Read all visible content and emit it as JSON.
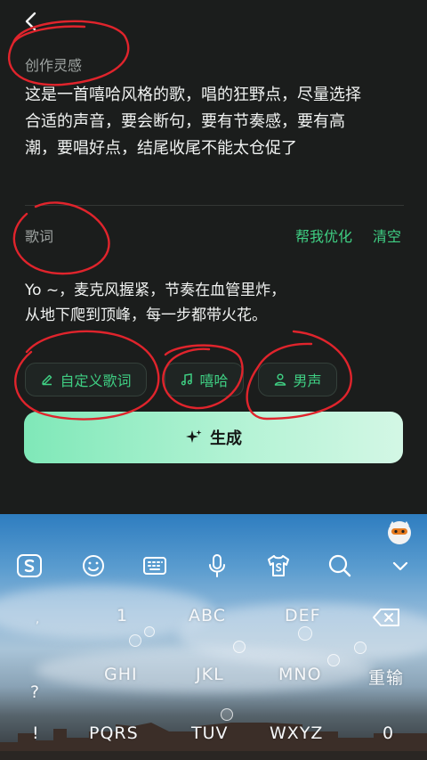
{
  "header": {
    "back_icon": "chevron-left-icon"
  },
  "inspiration": {
    "label": "创作灵感",
    "lines": [
      "这是一首嘻哈风格的歌，唱的狂野点，尽量选择",
      "合适的声音，要会断句，要有节奏感，要有高",
      "潮，要唱好点，结尾收尾不能太仓促了"
    ]
  },
  "lyrics": {
    "label": "歌词",
    "optimize_label": "帮我优化",
    "clear_label": "清空",
    "lines": [
      "Yo ~，麦克风握紧，节奏在血管里炸，",
      "从地下爬到顶峰，每一步都带火花。"
    ]
  },
  "chips": [
    {
      "icon": "pencil-icon",
      "label": "自定义歌词"
    },
    {
      "icon": "music-note-icon",
      "label": "嘻哈"
    },
    {
      "icon": "person-icon",
      "label": "男声"
    }
  ],
  "generate": {
    "icon": "sparkle-icon",
    "label": "生成"
  },
  "keyboard": {
    "toolbar_icons": [
      "sogou-logo-icon",
      "emoji-icon",
      "keyboard-icon",
      "microphone-icon",
      "skin-tshirt-icon",
      "search-icon",
      "chevron-down-icon"
    ],
    "row1": [
      "1",
      "ABC",
      "DEF"
    ],
    "row2": [
      "GHI",
      "JKL",
      "MNO",
      "重输"
    ],
    "row3": [
      "PQRS",
      "TUV",
      "WXYZ",
      "0"
    ],
    "side_symbols": [
      "?",
      "!"
    ],
    "backspace_icon": "backspace-icon",
    "mascot_icon": "mascot-icon"
  },
  "colors": {
    "accent": "#3fcf83",
    "background": "#1b1d1c",
    "annotation": "#e0242c"
  }
}
